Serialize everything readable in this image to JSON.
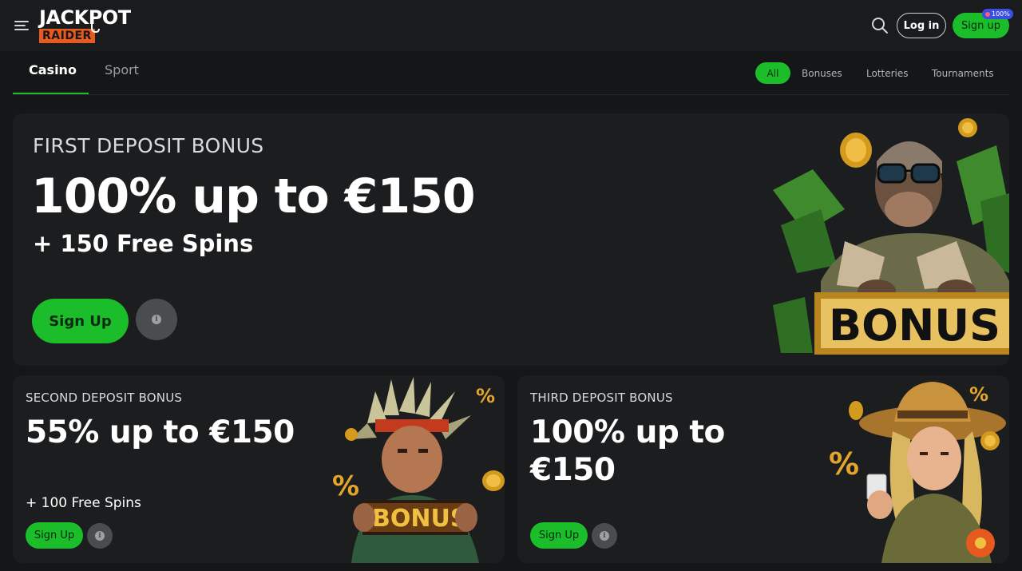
{
  "header": {
    "logo_top": "JACKPOT",
    "logo_bottom": "RAIDER",
    "login_label": "Log in",
    "signup_label": "Sign up",
    "signup_badge": "100%"
  },
  "tabs": [
    {
      "label": "Casino",
      "active": true
    },
    {
      "label": "Sport",
      "active": false
    }
  ],
  "filters": [
    {
      "label": "All",
      "active": true
    },
    {
      "label": "Bonuses",
      "active": false
    },
    {
      "label": "Lotteries",
      "active": false
    },
    {
      "label": "Tournaments",
      "active": false
    }
  ],
  "hero": {
    "kicker": "FIRST DEPOSIT BONUS",
    "title": "100% up to €150",
    "subtitle": "+ 150 Free Spins",
    "cta": "Sign Up",
    "art_text": "BONUS"
  },
  "cards": [
    {
      "kicker": "SECOND DEPOSIT BONUS",
      "title": "55% up to €150",
      "subtitle": "+ 100 Free Spins",
      "cta": "Sign Up",
      "art_text": "BONUS"
    },
    {
      "kicker": "THIRD DEPOSIT BONUS",
      "title": "100% up to €150",
      "subtitle": "",
      "cta": "Sign Up"
    }
  ],
  "colors": {
    "accent": "#1bbd2a",
    "background": "#141617",
    "card": "#1b1d1e",
    "logo_orange": "#e65a1f"
  },
  "icons": [
    "menu-icon",
    "search-icon",
    "info-icon"
  ]
}
